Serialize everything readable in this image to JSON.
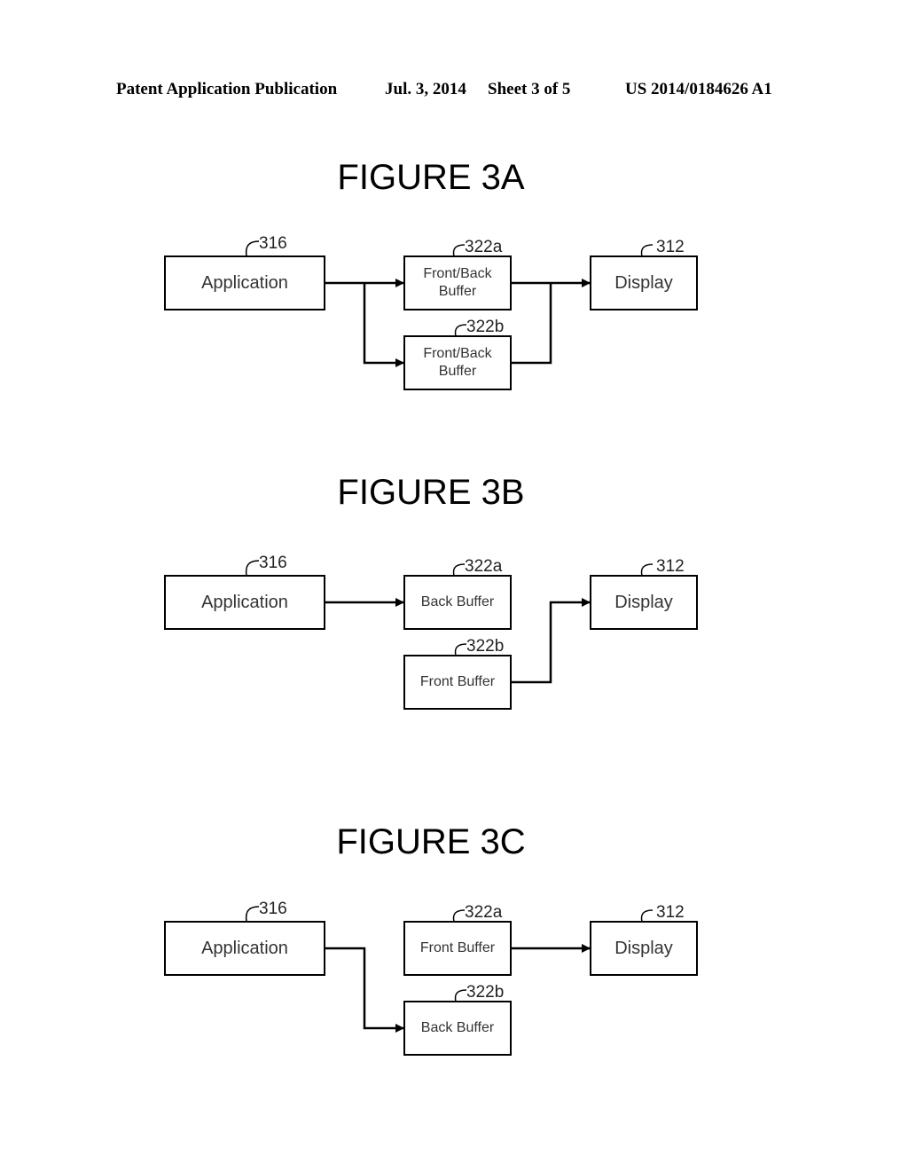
{
  "header": {
    "publication": "Patent Application Publication",
    "date": "Jul. 3, 2014",
    "sheet": "Sheet 3 of 5",
    "number": "US 2014/0184626 A1"
  },
  "figures": [
    {
      "title": "FIGURE 3A",
      "boxes": [
        {
          "label": "Application",
          "ref": "316"
        },
        {
          "label": "Front/Back Buffer",
          "ref": "322a"
        },
        {
          "label": "Front/Back Buffer",
          "ref": "322b"
        },
        {
          "label": "Display",
          "ref": "312"
        }
      ]
    },
    {
      "title": "FIGURE 3B",
      "boxes": [
        {
          "label": "Application",
          "ref": "316"
        },
        {
          "label": "Back Buffer",
          "ref": "322a"
        },
        {
          "label": "Front Buffer",
          "ref": "322b"
        },
        {
          "label": "Display",
          "ref": "312"
        }
      ]
    },
    {
      "title": "FIGURE 3C",
      "boxes": [
        {
          "label": "Application",
          "ref": "316"
        },
        {
          "label": "Front Buffer",
          "ref": "322a"
        },
        {
          "label": "Back Buffer",
          "ref": "322b"
        },
        {
          "label": "Display",
          "ref": "312"
        }
      ]
    }
  ]
}
